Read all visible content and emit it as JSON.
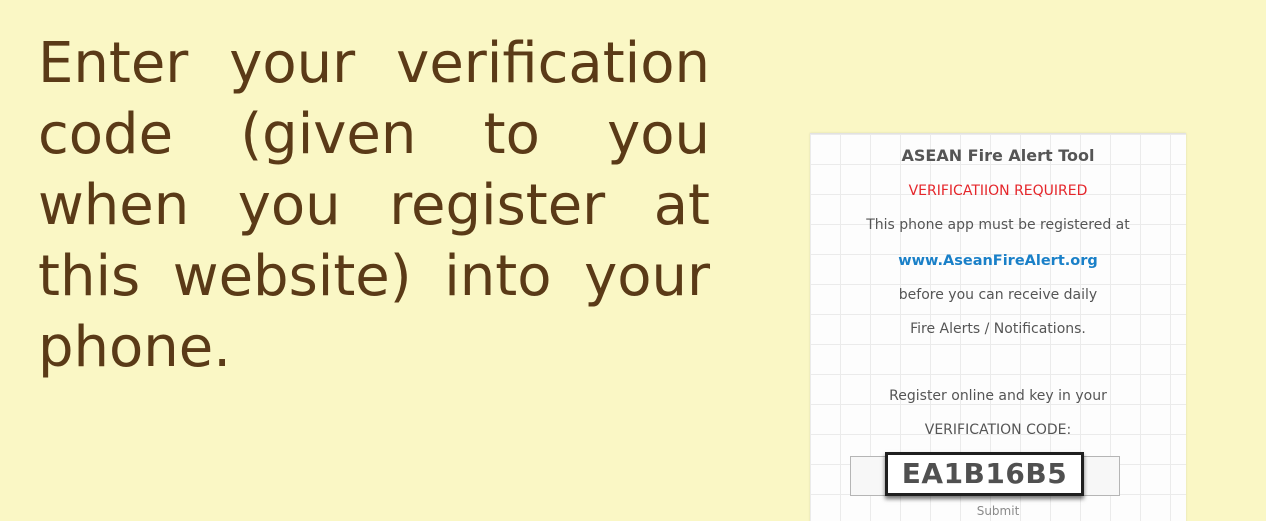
{
  "instruction": {
    "text": "Enter your verification code (given to you when you register at this website) into your phone."
  },
  "phone": {
    "app_title": "ASEAN Fire Alert Tool",
    "verification_required": "VERIFICATIION REQUIRED",
    "registration_note_1": "This phone app must be registered at",
    "website": "www.AseanFireAlert.org",
    "registration_note_2": "before you can receive daily",
    "registration_note_3": "Fire Alerts / Notifications.",
    "register_prompt_1": "Register online and key in your",
    "register_prompt_2": "VERIFICATION CODE:",
    "verification_code": "EA1B16B5",
    "submit_label": "Submit"
  },
  "colors": {
    "background": "#faf7c5",
    "instruction_text": "#5a3a17",
    "alert_red": "#e5262b",
    "link_blue": "#1a80c8"
  }
}
